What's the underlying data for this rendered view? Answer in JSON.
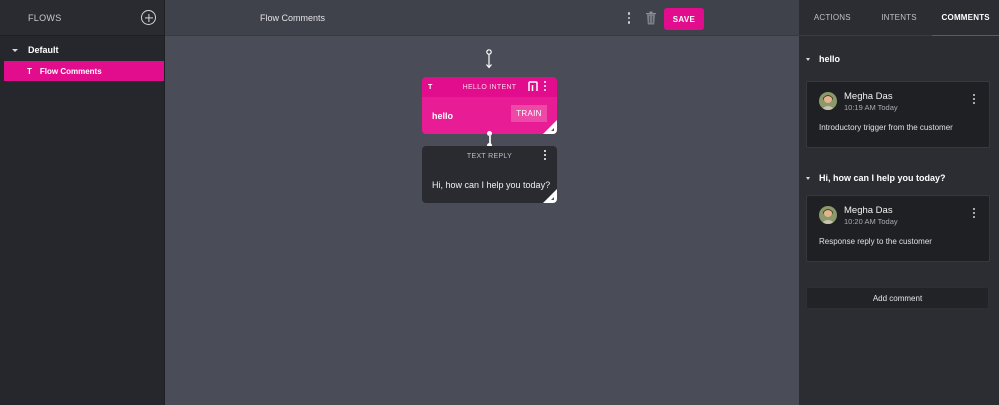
{
  "sidebar": {
    "title": "FLOWS",
    "group_label": "Default",
    "item_icon": "T",
    "item_label": "Flow Comments"
  },
  "topbar": {
    "flow_title": "Flow Comments",
    "save_label": "SAVE"
  },
  "nodes": {
    "intent": {
      "icon": "T",
      "header": "HELLO INTENT",
      "label": "hello",
      "train_label": "TRAIN"
    },
    "reply": {
      "header": "TEXT REPLY",
      "text": "Hi, how can I help you today?"
    }
  },
  "panel": {
    "tabs": [
      {
        "label": "ACTIONS",
        "active": false
      },
      {
        "label": "INTENTS",
        "active": false
      },
      {
        "label": "COMMENTS",
        "active": true
      }
    ],
    "sections": [
      {
        "title": "hello",
        "comment": {
          "author": "Megha Das",
          "time": "10:19 AM Today",
          "text": "Introductory trigger from the customer"
        }
      },
      {
        "title": "Hi, how can I help you today?",
        "comment": {
          "author": "Megha Das",
          "time": "10:20 AM Today",
          "text": "Response reply to the customer"
        }
      }
    ],
    "add_comment_label": "Add comment"
  },
  "colors": {
    "accent": "#e20d8c",
    "canvas_bg": "#4a4c58",
    "sidebar_bg": "#26272c",
    "card_bg": "#1f2024"
  },
  "icons": [
    "add-circle-icon",
    "caret-down-icon",
    "text-icon",
    "kebab-menu-icon",
    "trash-icon",
    "drag-handle-icon",
    "intent-node-icon",
    "resize-corner-icon",
    "avatar"
  ]
}
